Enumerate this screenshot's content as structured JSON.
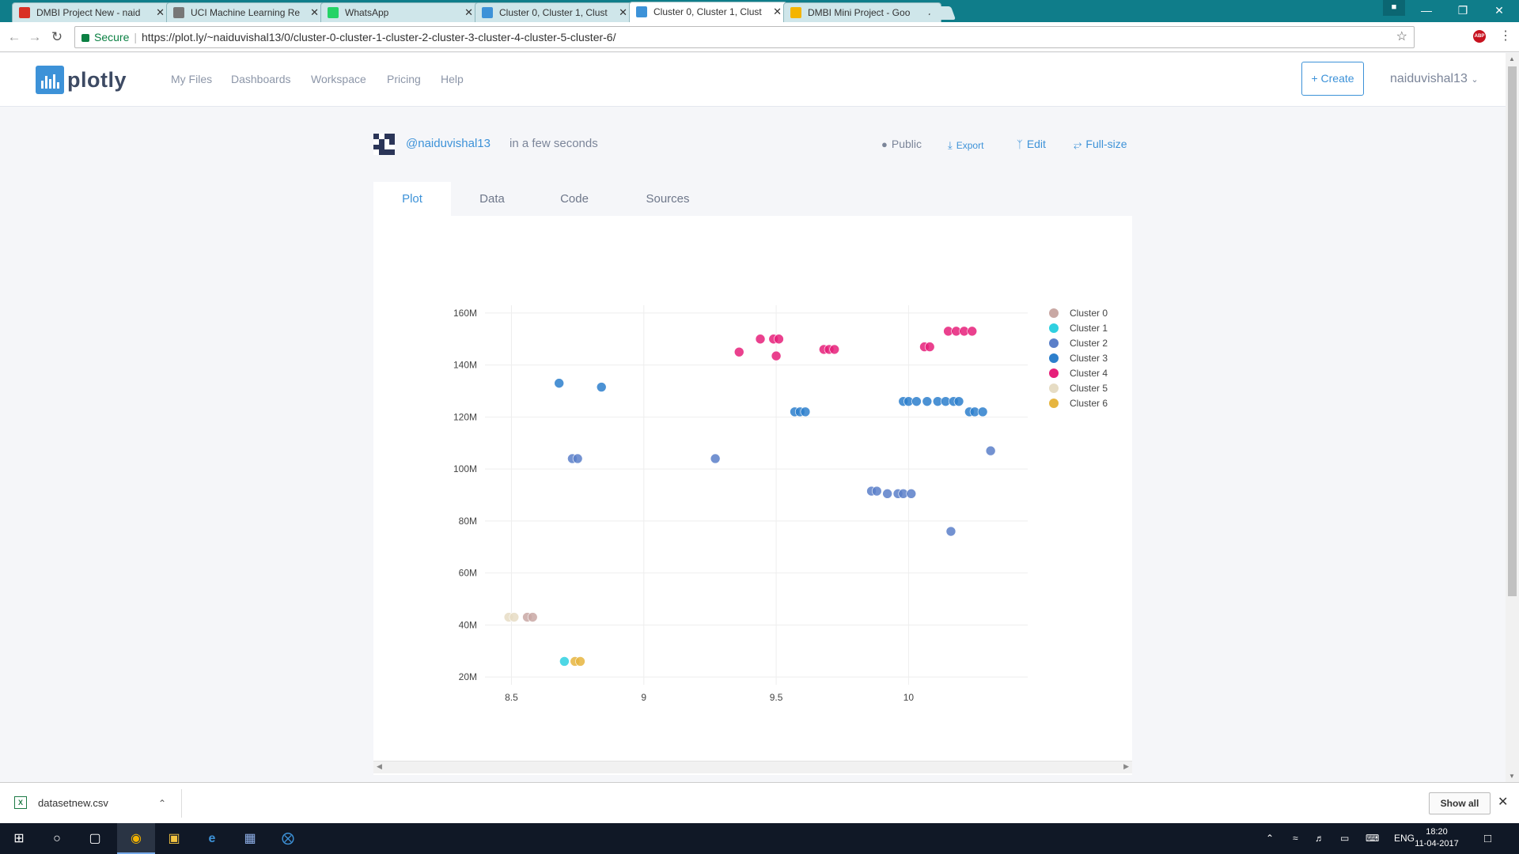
{
  "browser": {
    "tabs": [
      {
        "title": "DMBI Project New - naid",
        "favicon": "gmail-icon",
        "color": "#d93025",
        "active": false
      },
      {
        "title": "UCI Machine Learning Re",
        "favicon": "page-icon",
        "color": "#777777",
        "active": false
      },
      {
        "title": "WhatsApp",
        "favicon": "whatsapp-icon",
        "color": "#25d366",
        "active": false
      },
      {
        "title": "Cluster 0, Cluster 1, Clust",
        "favicon": "plotly-icon",
        "color": "#3d92d8",
        "active": false
      },
      {
        "title": "Cluster 0, Cluster 1, Clust",
        "favicon": "plotly-icon",
        "color": "#3d92d8",
        "active": true
      },
      {
        "title": "DMBI Mini Project - Goo",
        "favicon": "drive-icon",
        "color": "#f4b400",
        "active": false
      }
    ],
    "secure_label": "Secure",
    "url": "https://plot.ly/~naiduvishal13/0/cluster-0-cluster-1-cluster-2-cluster-3-cluster-4-cluster-5-cluster-6/"
  },
  "header": {
    "logo_text": "plotly",
    "nav": [
      "My Files",
      "Dashboards",
      "Workspace",
      "Pricing",
      "Help"
    ],
    "create_label": "+ Create",
    "username": "naiduvishal13"
  },
  "plot_meta": {
    "owner": "@naiduvishal13",
    "updated": "in a few seconds",
    "public_label": "Public",
    "export_label": "Export",
    "edit_label": "Edit",
    "fullsize_label": "Full-size"
  },
  "plot_tabs": [
    "Plot",
    "Data",
    "Code",
    "Sources"
  ],
  "chart_data": {
    "type": "scatter",
    "title": "",
    "xlabel": "",
    "ylabel": "",
    "xlim": [
      8.4,
      10.45
    ],
    "ylim": [
      17000000,
      163000000
    ],
    "xticks": [
      8.5,
      9,
      9.5,
      10
    ],
    "xtick_labels": [
      "8.5",
      "9",
      "9.5",
      "10"
    ],
    "yticks": [
      20000000,
      40000000,
      60000000,
      80000000,
      100000000,
      120000000,
      140000000,
      160000000
    ],
    "ytick_labels": [
      "20M",
      "40M",
      "60M",
      "80M",
      "100M",
      "120M",
      "140M",
      "160M"
    ],
    "grid": true,
    "legend_position": "right",
    "series": [
      {
        "name": "Cluster 0",
        "color": "#c9a8a4",
        "x": [
          8.56,
          8.58
        ],
        "y": [
          43000000,
          43000000
        ]
      },
      {
        "name": "Cluster 1",
        "color": "#2fd0e0",
        "x": [
          8.7
        ],
        "y": [
          26000000
        ]
      },
      {
        "name": "Cluster 2",
        "color": "#5b7fc9",
        "x": [
          8.73,
          8.75,
          9.27,
          9.86,
          9.88,
          9.92,
          9.96,
          9.98,
          10.01,
          10.16,
          10.31
        ],
        "y": [
          104000000,
          104000000,
          104000000,
          91500000,
          91500000,
          90500000,
          90500000,
          90500000,
          90500000,
          76000000,
          107000000
        ]
      },
      {
        "name": "Cluster 3",
        "color": "#2d7fcc",
        "x": [
          8.68,
          8.84,
          9.57,
          9.59,
          9.61,
          9.98,
          10.0,
          10.03,
          10.07,
          10.11,
          10.14,
          10.17,
          10.19,
          10.23,
          10.25,
          10.28
        ],
        "y": [
          133000000,
          131500000,
          122000000,
          122000000,
          122000000,
          126000000,
          126000000,
          126000000,
          126000000,
          126000000,
          126000000,
          126000000,
          126000000,
          122000000,
          122000000,
          122000000
        ]
      },
      {
        "name": "Cluster 4",
        "color": "#e6207a",
        "x": [
          9.36,
          9.44,
          9.49,
          9.51,
          9.5,
          9.68,
          9.7,
          9.72,
          10.06,
          10.08,
          10.15,
          10.18,
          10.21,
          10.24
        ],
        "y": [
          145000000,
          150000000,
          150000000,
          150000000,
          143500000,
          146000000,
          146000000,
          146000000,
          147000000,
          147000000,
          153000000,
          153000000,
          153000000,
          153000000
        ]
      },
      {
        "name": "Cluster 5",
        "color": "#e6dcc4",
        "x": [
          8.49,
          8.51
        ],
        "y": [
          43000000,
          43000000
        ]
      },
      {
        "name": "Cluster 6",
        "color": "#e6b540",
        "x": [
          8.74,
          8.76
        ],
        "y": [
          26000000,
          26000000
        ]
      }
    ]
  },
  "downloads": {
    "file": "datasetnew.csv",
    "show_all": "Show all"
  },
  "system": {
    "language": "ENG",
    "time": "18:20",
    "date": "11-04-2017"
  }
}
